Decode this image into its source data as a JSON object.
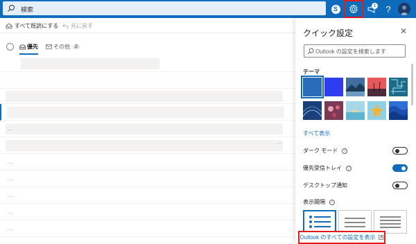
{
  "header": {
    "search_placeholder": "検索",
    "skype_icon": "skype-icon",
    "settings_icon": "gear-icon",
    "announcement_badge": "1",
    "help_icon": "help-icon",
    "accent_color": "#0f6cbd",
    "highlight_color": "#e21a1a"
  },
  "commands": {
    "mark_all_read": "すべて既読にする",
    "undo": "元に戻す"
  },
  "mail_tabs": {
    "focused": "優先",
    "other": "その他",
    "other_count": "2"
  },
  "quick_settings": {
    "title": "クイック設定",
    "search_placeholder": "Outlook の設定を検索します",
    "theme_label": "テーマ",
    "themes": [
      "blue",
      "bright-blue",
      "mountain",
      "palms",
      "circuit",
      "stars",
      "bokeh",
      "beach",
      "starfish",
      "waves"
    ],
    "show_all": "すべて表示",
    "dark_mode": {
      "label": "ダーク モード",
      "on": false
    },
    "focused_inbox": {
      "label": "優先受信トレイ",
      "on": true
    },
    "desktop_notifications": {
      "label": "デスクトップ通知",
      "on": false
    },
    "density_label": "表示間隔",
    "density_options": [
      "full",
      "medium",
      "compact"
    ],
    "view_all_settings": "Outlook のすべての設定を表示"
  }
}
